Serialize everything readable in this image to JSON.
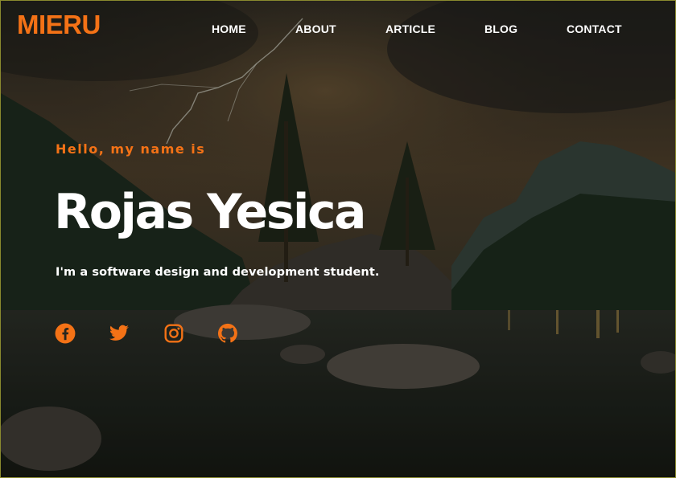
{
  "brand": {
    "logo_text": "MIERU",
    "accent_color": "#f47216"
  },
  "nav": {
    "items": [
      {
        "label": "HOME"
      },
      {
        "label": "ABOUT"
      },
      {
        "label": "ARTICLE"
      },
      {
        "label": "BLOG"
      },
      {
        "label": "CONTACT"
      }
    ]
  },
  "hero": {
    "greeting": "Hello, my name is",
    "name": "Rojas Yesica",
    "tagline": "I'm a software design and development student."
  },
  "social": {
    "icons": [
      "facebook-icon",
      "twitter-icon",
      "instagram-icon",
      "github-icon"
    ]
  }
}
